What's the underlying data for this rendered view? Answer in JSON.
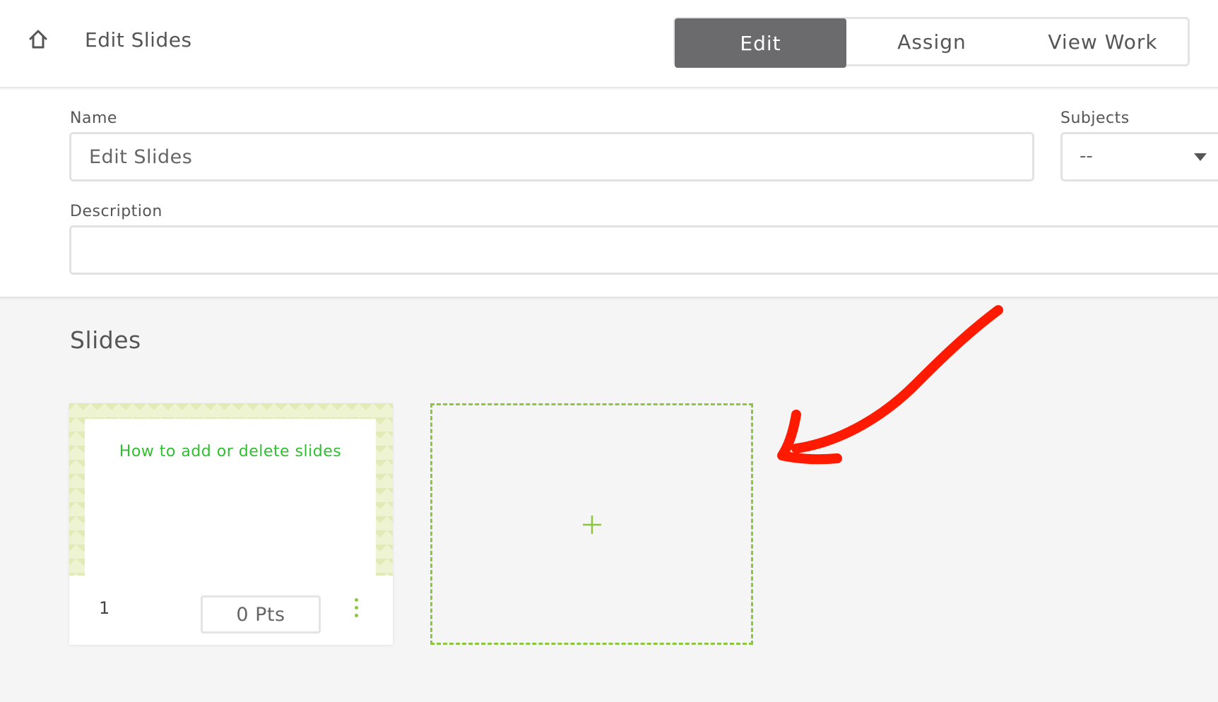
{
  "header": {
    "title": "Edit Slides",
    "home_icon": "home-icon",
    "tabs": [
      {
        "label": "Edit",
        "active": true
      },
      {
        "label": "Assign",
        "active": false
      },
      {
        "label": "View Work",
        "active": false
      }
    ]
  },
  "form": {
    "name_label": "Name",
    "name_value": "Edit Slides",
    "subjects_label": "Subjects",
    "subjects_value": "--",
    "description_label": "Description",
    "description_value": ""
  },
  "slides": {
    "heading": "Slides",
    "items": [
      {
        "number": "1",
        "title": "How to add or delete slides",
        "points": "0 Pts"
      }
    ],
    "add_icon": "plus-icon"
  },
  "colors": {
    "active_tab": "#6b6b6d",
    "accent_green": "#8cc63f",
    "slide_title_green": "#2fbf2f",
    "annotation_red": "#ff1a00"
  }
}
